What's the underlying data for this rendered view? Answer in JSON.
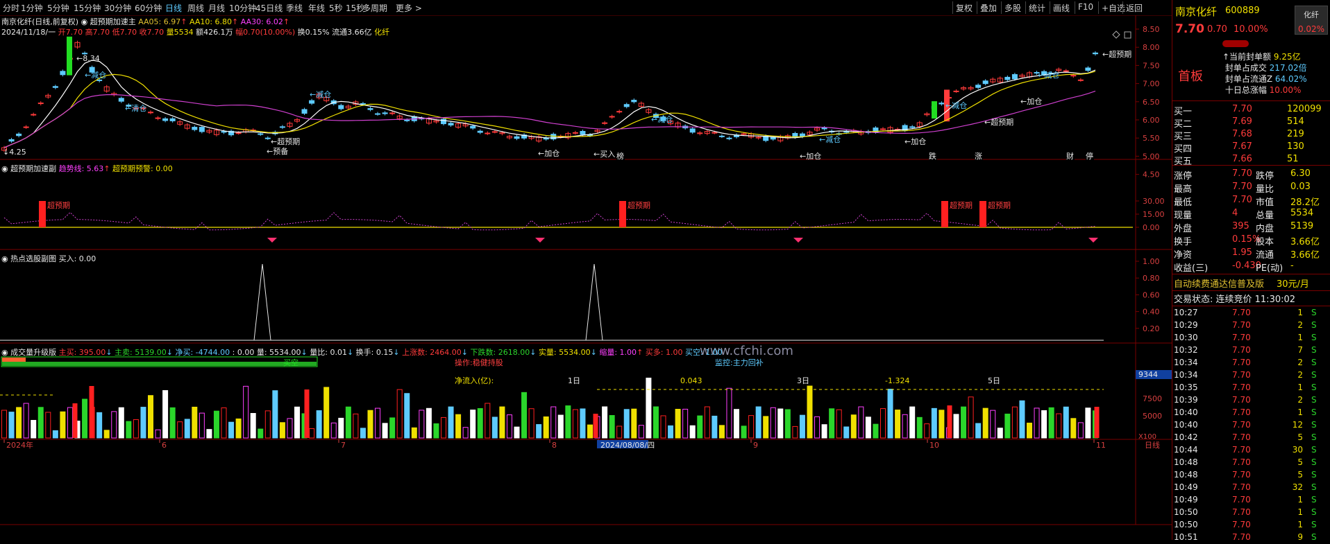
{
  "toolbar": {
    "tabs": [
      "分时",
      "1分钟",
      "5分钟",
      "15分钟",
      "30分钟",
      "60分钟",
      "日线",
      "周线",
      "月线",
      "10分钟",
      "45日线",
      "季线",
      "年线",
      "5秒",
      "15秒",
      "多周期",
      "更多 >"
    ],
    "active_tab": "日线",
    "buttons": [
      "复权",
      "叠加",
      "多股",
      "统计",
      "画线",
      "F10",
      "+自选",
      "返回"
    ]
  },
  "main_panel": {
    "title": "南京化纤(日线,前复权)",
    "indicator": "超预期加速主",
    "ma5": "AA05: 6.97",
    "ma10": "AA10: 6.80",
    "ma30": "AA30: 6.02",
    "date": "2024/11/18/一",
    "open": "开7.70",
    "high": "高7.70",
    "low": "低7.70",
    "close": "收7.70",
    "vol": "量5534",
    "amount": "额426.1万",
    "pct": "幅0.70(10.00%)",
    "turnover": "换0.15%",
    "float": "流通3.66亿",
    "name_tag": "化纤",
    "y_labels": [
      "8.50",
      "8.00",
      "7.50",
      "7.00",
      "6.50",
      "6.00",
      "5.50",
      "5.00",
      "4.50"
    ],
    "hi_label": "8.34",
    "lo_label": "4.25",
    "annotations": [
      "减仓",
      "清仓",
      "减仓",
      "减仓",
      "减仓",
      "减仓",
      "减仓",
      "加仓",
      "加仓",
      "加仓",
      "加仓",
      "加仓",
      "超预期",
      "超预期",
      "超预期",
      "超预期",
      "买入",
      "预备"
    ],
    "event_marks": [
      "榜",
      "跌",
      "涨",
      "财",
      "停"
    ]
  },
  "panel2": {
    "title": "超预期加速副",
    "trend": "趋势线: 5.63",
    "alert": "超预期预警: 0.00",
    "y_labels": [
      "30.00",
      "15.00",
      "0.00"
    ],
    "label": "超预期"
  },
  "panel3": {
    "title": "热点选股副图",
    "buy": "买入: 0.00",
    "y_labels": [
      "1.00",
      "0.80",
      "0.60",
      "0.40",
      "0.20"
    ]
  },
  "panel4": {
    "title": "成交量升级版",
    "zhumai": "主买: 395.00",
    "zhumai2": "主卖: 5139.00",
    "jingmai": "净买: -4744.00",
    "misc": ": 0.00",
    "liang": "量: 5534.00",
    "liangbi": "量比: 0.01",
    "huanshou": "换手: 0.15",
    "shangzhang": "上涨数: 2464.00",
    "xiadie": "下跌数: 2618.00",
    "shiliang": "实量: 5534.00",
    "suoliang": "缩量: 1.00",
    "maiduo": "买多: 1.00",
    "maikong": "买空: 1.00",
    "tip1": "操作:稳健持股",
    "tip2": "监控:主力回补",
    "tip3": "买空",
    "netflow": "净流入(亿):",
    "d1": "1日",
    "d1v": "0.043",
    "d3": "3日",
    "d3v": "-1.324",
    "d5": "5日",
    "y_labels": [
      "9344",
      "7500",
      "5000",
      "X100"
    ],
    "watermark": "www.cfchi.com"
  },
  "x_axis": [
    "2024年",
    "6",
    "7",
    "8",
    "2024/08/08/四",
    "9",
    "10",
    "11",
    "日线"
  ],
  "quote": {
    "name": "南京化纤",
    "code": "600889",
    "badge": "化纤",
    "price": "7.70",
    "change": "0.70",
    "pct": "10.00%",
    "badge_pct": "0.02%",
    "board": "首板",
    "seal_amt_label": "↑当前封单额",
    "seal_amt": "9.25亿",
    "seal_deal_label": "封单占成交",
    "seal_deal": "217.02倍",
    "seal_float_label": "封单占流通Z",
    "seal_float": "64.02%",
    "ten_day_label": "十日总涨幅",
    "ten_day": "10.00%",
    "bids": [
      {
        "label": "买一",
        "price": "7.70",
        "vol": "120099"
      },
      {
        "label": "买二",
        "price": "7.69",
        "vol": "514"
      },
      {
        "label": "买三",
        "price": "7.68",
        "vol": "219"
      },
      {
        "label": "买四",
        "price": "7.67",
        "vol": "130"
      },
      {
        "label": "买五",
        "price": "7.66",
        "vol": "51"
      }
    ],
    "stats": [
      {
        "l1": "涨停",
        "v1": "7.70",
        "l2": "跌停",
        "v2": "6.30"
      },
      {
        "l1": "最高",
        "v1": "7.70",
        "l2": "量比",
        "v2": "0.03"
      },
      {
        "l1": "最低",
        "v1": "7.70",
        "l2": "市值",
        "v2": "28.2亿"
      },
      {
        "l1": "现量",
        "v1": "4",
        "l2": "总量",
        "v2": "5534"
      },
      {
        "l1": "外盘",
        "v1": "395",
        "l2": "内盘",
        "v2": "5139"
      },
      {
        "l1": "换手",
        "v1": "0.15%",
        "l2": "股本",
        "v2": "3.66亿"
      },
      {
        "l1": "净资",
        "v1": "1.95",
        "l2": "流通",
        "v2": "3.66亿"
      },
      {
        "l1": "收益(三)",
        "v1": "-0.430",
        "l2": "PE(动)",
        "v2": "-"
      }
    ],
    "promo": "自动续费通达信普及版",
    "promo_price": "30元/月",
    "trade_status": "交易状态: 连续竞价 11:30:02",
    "ticks": [
      {
        "t": "10:27",
        "p": "7.70",
        "v": "1",
        "s": "S"
      },
      {
        "t": "10:29",
        "p": "7.70",
        "v": "2",
        "s": "S"
      },
      {
        "t": "10:30",
        "p": "7.70",
        "v": "1",
        "s": "S"
      },
      {
        "t": "10:32",
        "p": "7.70",
        "v": "7",
        "s": "S"
      },
      {
        "t": "10:34",
        "p": "7.70",
        "v": "2",
        "s": "S"
      },
      {
        "t": "10:34",
        "p": "7.70",
        "v": "2",
        "s": "S"
      },
      {
        "t": "10:35",
        "p": "7.70",
        "v": "1",
        "s": "S"
      },
      {
        "t": "10:39",
        "p": "7.70",
        "v": "2",
        "s": "S"
      },
      {
        "t": "10:40",
        "p": "7.70",
        "v": "1",
        "s": "S"
      },
      {
        "t": "10:40",
        "p": "7.70",
        "v": "12",
        "s": "S"
      },
      {
        "t": "10:42",
        "p": "7.70",
        "v": "5",
        "s": "S"
      },
      {
        "t": "10:44",
        "p": "7.70",
        "v": "30",
        "s": "S"
      },
      {
        "t": "10:48",
        "p": "7.70",
        "v": "5",
        "s": "S"
      },
      {
        "t": "10:48",
        "p": "7.70",
        "v": "5",
        "s": "S"
      },
      {
        "t": "10:49",
        "p": "7.70",
        "v": "32",
        "s": "S"
      },
      {
        "t": "10:49",
        "p": "7.70",
        "v": "1",
        "s": "S"
      },
      {
        "t": "10:50",
        "p": "7.70",
        "v": "1",
        "s": "S"
      },
      {
        "t": "10:50",
        "p": "7.70",
        "v": "1",
        "s": "S"
      },
      {
        "t": "10:51",
        "p": "7.70",
        "v": "9",
        "s": "S"
      }
    ]
  },
  "colors": {
    "up": "#ff3b3b",
    "down": "#5ecbff",
    "ma5": "#ffffff",
    "ma10": "#f0e000",
    "ma30": "#d040d0",
    "grid": "#7a0000"
  }
}
